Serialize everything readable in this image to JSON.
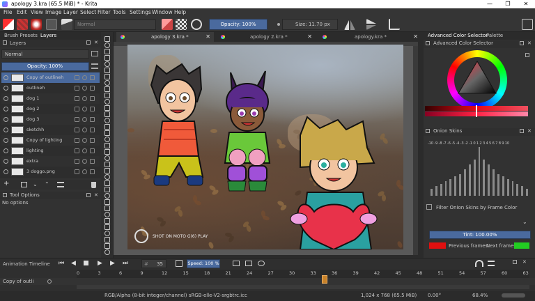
{
  "window": {
    "title": "apology 3.kra (65.5 MiB)  * - Krita",
    "min": "—",
    "max": "❐",
    "close": "✕"
  },
  "menu": [
    "File",
    "Edit",
    "View",
    "Image",
    "Layer",
    "Select",
    "Filter",
    "Tools",
    "Settings",
    "Window",
    "Help"
  ],
  "toolbar": {
    "blend_mode": "Normal",
    "opacity": "Opacity: 100%",
    "size": "Size: 11.70 px"
  },
  "left_dock": {
    "tabs": [
      "Brush Presets",
      "Layers"
    ],
    "layers_title": "Layers",
    "blend": "Normal",
    "opacity": "Opacity:  100%",
    "layers": [
      {
        "name": "Copy of outlineh",
        "selected": true
      },
      {
        "name": "outlineh",
        "selected": false
      },
      {
        "name": "dog 1",
        "selected": false
      },
      {
        "name": "dog 2",
        "selected": false
      },
      {
        "name": "dog 3",
        "selected": false
      },
      {
        "name": "sketchh",
        "selected": false
      },
      {
        "name": "Copy of lighting",
        "selected": false
      },
      {
        "name": "lighting",
        "selected": false
      },
      {
        "name": "extra",
        "selected": false
      },
      {
        "name": "3 doggo.png",
        "selected": false
      }
    ],
    "tool_options_title": "Tool Options",
    "no_options": "No options"
  },
  "doc_tabs": [
    {
      "label": "apology 3.kra *",
      "active": true
    },
    {
      "label": "apology 2.kra *",
      "active": false
    },
    {
      "label": "apology.kra *",
      "active": false
    }
  ],
  "canvas": {
    "watermark": "SHOT ON MOTO G(6) PLAY"
  },
  "right_dock": {
    "tabs": [
      "Advanced Color Selector",
      "Palette"
    ],
    "color_title": "Advanced Color Selector",
    "onion_title": "Onion Skins",
    "onion_numbers": "-10 -9 -8 -7 -6 -5 -4 -3 -2 -1  0  1  2  3  4  5  6  7  8  9 10",
    "onion_bars": [
      0.15,
      0.2,
      0.25,
      0.3,
      0.35,
      0.4,
      0.45,
      0.55,
      0.65,
      0.75,
      1.0,
      0.75,
      0.65,
      0.55,
      0.45,
      0.4,
      0.35,
      0.3,
      0.25,
      0.2,
      0.15
    ],
    "filter_label": "Filter Onion Skins by Frame Color",
    "tint": "Tint: 100.00%",
    "previous": "Previous frames",
    "next": "Next frames",
    "prev_color": "#e01010",
    "next_color": "#22cc22"
  },
  "timeline": {
    "title": "Animation Timeline",
    "frame": "35",
    "speed": "Speed: 100 %",
    "ruler": [
      "0",
      "3",
      "6",
      "9",
      "12",
      "15",
      "18",
      "21",
      "24",
      "27",
      "30",
      "33",
      "36",
      "39",
      "42",
      "45",
      "48",
      "51",
      "54",
      "57",
      "60",
      "63"
    ],
    "layer": "Copy of outli"
  },
  "status": {
    "color_model": "RGB/Alpha (8-bit integer/channel)  sRGB-elle-V2-srgbtrc.icc",
    "dimensions": "1,024 x 768 (65.5 MiB)",
    "rotation": "0.00°",
    "zoom": "68.4%"
  }
}
